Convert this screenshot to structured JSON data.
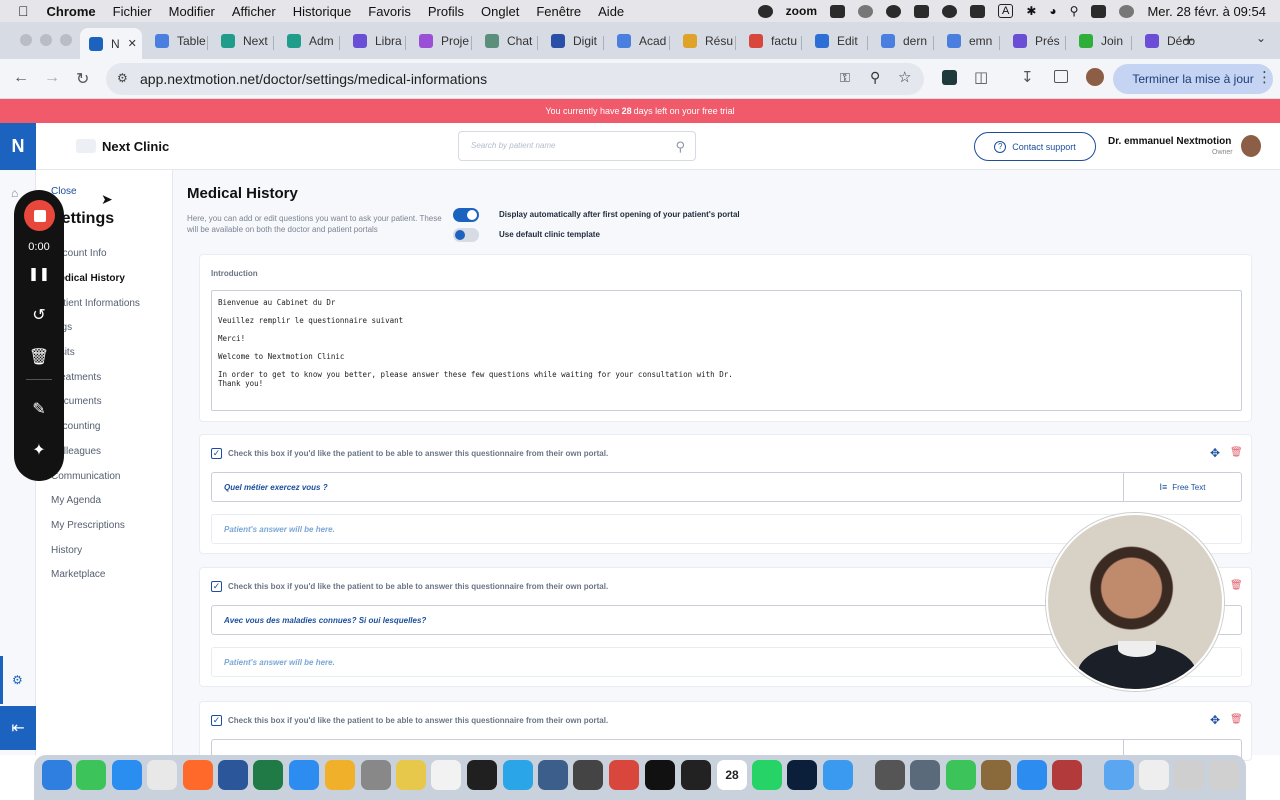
{
  "menubar": {
    "app": "Chrome",
    "items": [
      "Fichier",
      "Modifier",
      "Afficher",
      "Historique",
      "Favoris",
      "Profils",
      "Onglet",
      "Fenêtre",
      "Aide"
    ],
    "zoom_label": "zoom",
    "input_source": "A",
    "datetime": "Mer. 28 févr. à 09:54"
  },
  "browser": {
    "tabs": [
      {
        "label": "N",
        "icon": "nextmotion-icon",
        "color": "#1c63bf",
        "active": true
      },
      {
        "label": "Table",
        "icon": "docs-icon",
        "color": "#4a7fe0"
      },
      {
        "label": "Next",
        "icon": "teal-app-icon",
        "color": "#1f9c8a"
      },
      {
        "label": "Adm",
        "icon": "teal-app-icon",
        "color": "#1f9c8a"
      },
      {
        "label": "Libra",
        "icon": "star-app-icon",
        "color": "#6a4fd6"
      },
      {
        "label": "Proje",
        "icon": "purple-app-icon",
        "color": "#9b4fd6"
      },
      {
        "label": "Chat",
        "icon": "chatgpt-icon",
        "color": "#5a8f7b"
      },
      {
        "label": "Digit",
        "icon": "notion-icon",
        "color": "#2b4fa6"
      },
      {
        "label": "Acad",
        "icon": "docs-icon",
        "color": "#4a7fe0"
      },
      {
        "label": "Résu",
        "icon": "drive-icon",
        "color": "#e0a32a"
      },
      {
        "label": "factu",
        "icon": "gmail-icon",
        "color": "#d9473c"
      },
      {
        "label": "Edit",
        "icon": "confluence-icon",
        "color": "#2e6fd6"
      },
      {
        "label": "dern",
        "icon": "google-icon",
        "color": "#4a7fe0"
      },
      {
        "label": "emn",
        "icon": "google-icon",
        "color": "#4a7fe0"
      },
      {
        "label": "Prés",
        "icon": "star-app-icon",
        "color": "#6a4fd6"
      },
      {
        "label": "Join",
        "icon": "green-app-icon",
        "color": "#2fae3a"
      },
      {
        "label": "Déco",
        "icon": "star-app-icon",
        "color": "#6a4fd6"
      }
    ],
    "url": "app.nextmotion.net/doctor/settings/medical-informations",
    "finish_setup": "Terminer la mise à jour"
  },
  "trial_banner": {
    "prefix": "You currently have",
    "days": "28",
    "suffix": "days left on your free trial"
  },
  "header": {
    "logo": "N",
    "clinic_name": "Next Clinic",
    "search_placeholder": "Search by patient name",
    "support_label": "Contact support",
    "user_name": "Dr. emmanuel Nextmotion",
    "user_role": "Owner"
  },
  "settings_nav": {
    "close": "Close",
    "title": "Settings",
    "items": [
      {
        "label": "Account Info"
      },
      {
        "label": "Medical History",
        "active": true
      },
      {
        "label": "Patient Informations"
      },
      {
        "label": "Tags"
      },
      {
        "label": "Visits"
      },
      {
        "label": "Treatments"
      },
      {
        "label": "Documents"
      },
      {
        "label": "Accounting"
      },
      {
        "label": "Colleagues"
      },
      {
        "label": "Communication"
      },
      {
        "label": "My Agenda"
      },
      {
        "label": "My Prescriptions"
      },
      {
        "label": "History"
      },
      {
        "label": "Marketplace"
      }
    ]
  },
  "recorder": {
    "time": "0:00"
  },
  "main": {
    "title": "Medical History",
    "description": "Here, you can add or edit questions you want to ask your patient. These will be available on both the doctor and patient portals",
    "toggle_display_auto": {
      "label": "Display automatically after first opening of your patient's portal",
      "on": true
    },
    "toggle_default_template": {
      "label": "Use default clinic template",
      "on": false
    },
    "introduction": {
      "label": "Introduction",
      "text": "Bienvenue au Cabinet du Dr\n\nVeuillez remplir le questionnaire suivant\n\nMerci!\n\nWelcome to Nextmotion Clinic\n\nIn order to get to know you better, please answer these few questions while waiting for your consultation with Dr.\nThank you!"
    },
    "questions": [
      {
        "checkbox_label": "Check this box if you'd like the patient to be able to answer this questionnaire from their own portal.",
        "question": "Quel métier exercez vous ?",
        "type": "Free Text",
        "answer_placeholder": "Patient's answer will be here."
      },
      {
        "checkbox_label": "Check this box if you'd like the patient to be able to answer this questionnaire from their own portal.",
        "question": "Avec vous des maladies connues? Si oui lesquelles?",
        "type": "Free Text",
        "answer_placeholder": "Patient's answer will be here."
      },
      {
        "checkbox_label": "Check this box if you'd like the patient to be able to answer this questionnaire from their own portal.",
        "question": "",
        "type": "",
        "answer_placeholder": ""
      }
    ]
  },
  "dock": {
    "date_day": "28"
  }
}
